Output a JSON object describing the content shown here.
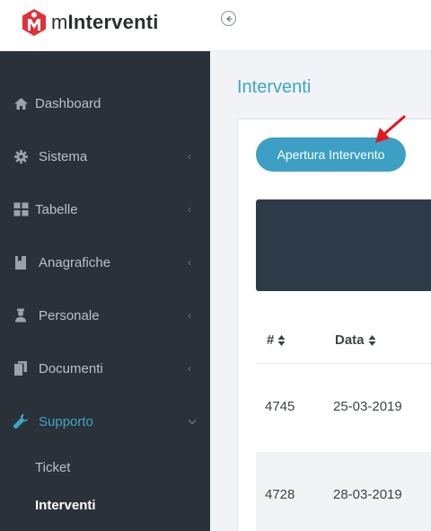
{
  "app": {
    "name_light": "m",
    "name_bold": "Interventi",
    "logo_letter": "M"
  },
  "header": {
    "collapse_icon": "‹"
  },
  "sidebar": {
    "items": [
      {
        "label": "Dashboard",
        "icon": "home-icon"
      },
      {
        "label": "Sistema",
        "icon": "gear-icon"
      },
      {
        "label": "Tabelle",
        "icon": "grid-icon"
      },
      {
        "label": "Anagrafiche",
        "icon": "book-icon"
      },
      {
        "label": "Personale",
        "icon": "person-icon"
      },
      {
        "label": "Documenti",
        "icon": "documents-icon"
      },
      {
        "label": "Supporto",
        "icon": "wrench-icon"
      }
    ],
    "sub_items": [
      {
        "label": "Ticket"
      },
      {
        "label": "Interventi"
      }
    ]
  },
  "main": {
    "title": "Interventi",
    "open_button": "Apertura Intervento",
    "table": {
      "columns": [
        "#",
        "Data"
      ],
      "rows": [
        {
          "id": "4745",
          "date": "25-03-2019"
        },
        {
          "id": "4728",
          "date": "28-03-2019"
        }
      ]
    }
  },
  "colors": {
    "accent": "#3ba6c9",
    "sidebar_bg": "#2a3138",
    "logo_red": "#e0313b",
    "arrow_red": "#e8151b"
  }
}
